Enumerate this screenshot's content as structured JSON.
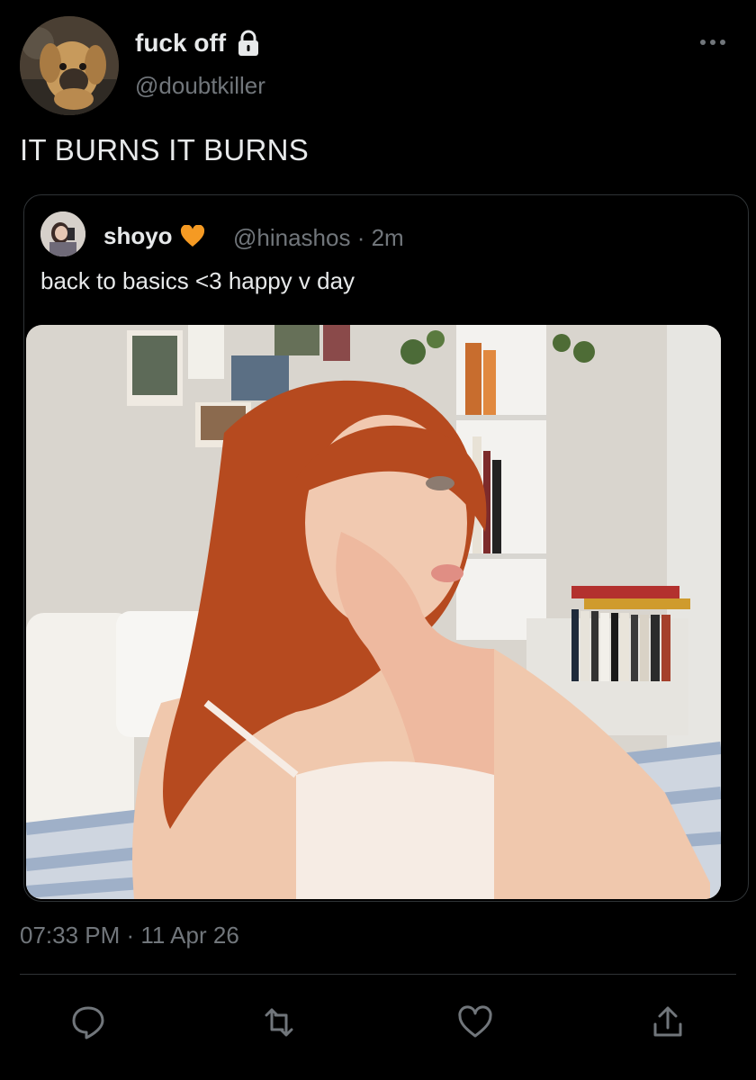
{
  "author": {
    "display_name": "fuck off",
    "handle": "@doubtkiller",
    "locked_icon": "lock-icon",
    "avatar_icon": "puppy-avatar"
  },
  "tweet": {
    "text": "IT BURNS IT BURNS",
    "timestamp": "07:33 PM · 11 Apr 26"
  },
  "quoted": {
    "display_name": "shoyo",
    "badge_icon": "orange-heart-icon",
    "handle_time": "@hinashos · 2m",
    "text": "back to basics <3 happy v day",
    "photo_icon": "woman-in-bedroom-photo"
  },
  "actions": [
    {
      "icon": "reply-icon"
    },
    {
      "icon": "retweet-icon"
    },
    {
      "icon": "like-icon"
    },
    {
      "icon": "share-icon"
    }
  ],
  "colors": {
    "background": "#000000",
    "text": "#e7e9ea",
    "muted": "#71767b",
    "border": "#2f3336",
    "heart": "#f59a23"
  }
}
